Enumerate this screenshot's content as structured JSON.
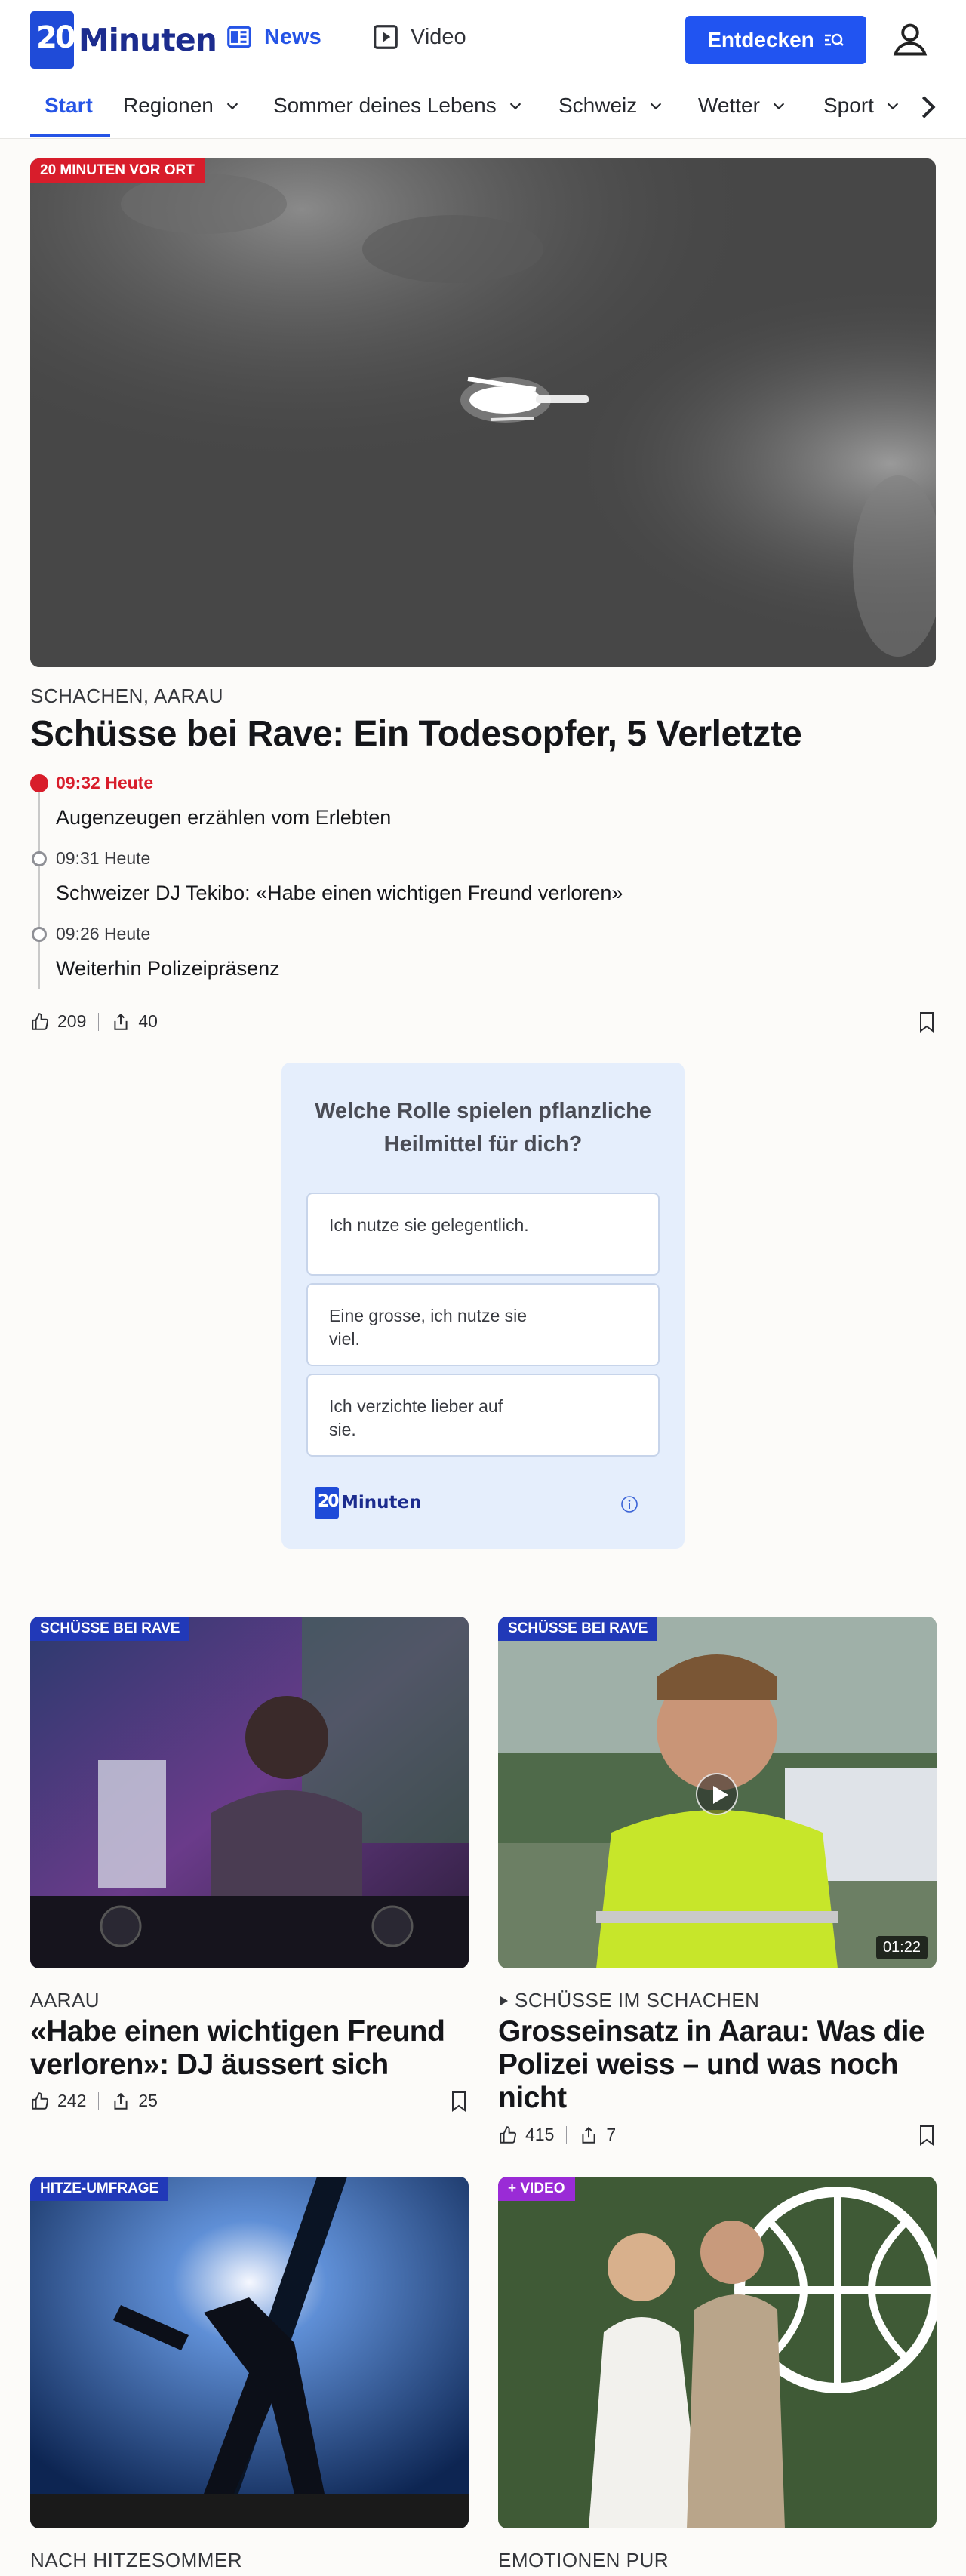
{
  "header": {
    "logo_text": "Minuten",
    "logo_mark": "20",
    "nav_news": "News",
    "nav_video": "Video",
    "discover_label": "Entdecken"
  },
  "categories": [
    "Start",
    "Regionen",
    "Sommer deines Lebens",
    "Schweiz",
    "Wetter",
    "Sport"
  ],
  "hero": {
    "tag": "20 MINUTEN VOR ORT",
    "kicker": "SCHACHEN, AARAU",
    "title": "Schüsse bei Rave: Ein Todesopfer, 5 Verletzte",
    "timeline": [
      {
        "time": "09:32 Heute",
        "text": "Augenzeugen erzählen vom Erlebten",
        "live": true
      },
      {
        "time": "09:31 Heute",
        "text": "Schweizer DJ Tekibo: «Habe einen wichtigen Freund verloren»",
        "live": false
      },
      {
        "time": "09:26 Heute",
        "text": "Weiterhin Polizeipräsenz",
        "live": false
      }
    ],
    "likes": "209",
    "shares": "40"
  },
  "poll": {
    "question": "Welche Rolle spielen pflanzliche Heilmittel für dich?",
    "options": [
      "Ich nutze sie gelegentlich.",
      "Eine grosse, ich nutze sie viel.",
      "Ich verzichte lieber auf sie."
    ],
    "logo_text": "Minuten",
    "logo_mark": "20"
  },
  "cards": [
    {
      "tag": "SCHÜSSE BEI RAVE",
      "kicker": "AARAU",
      "title": "«Habe einen wichtigen Freund verloren»: DJ äussert sich",
      "likes": "242",
      "shares": "25"
    },
    {
      "tag": "SCHÜSSE BEI RAVE",
      "kicker": "SCHÜSSE IM SCHACHEN",
      "title": "Grosseinsatz in Aarau: Was die Polizei weiss – und was noch nicht",
      "likes": "415",
      "shares": "7",
      "duration": "01:22"
    },
    {
      "tag": "HITZE-UMFRAGE",
      "kicker": "NACH HITZESOMMER"
    },
    {
      "tag": "+ VIDEO",
      "kicker": "EMOTIONEN PUR"
    }
  ],
  "colors": {
    "brand_blue": "#2154f1",
    "live_red": "#d81d2b",
    "logo_navy": "#1c2c8e"
  }
}
